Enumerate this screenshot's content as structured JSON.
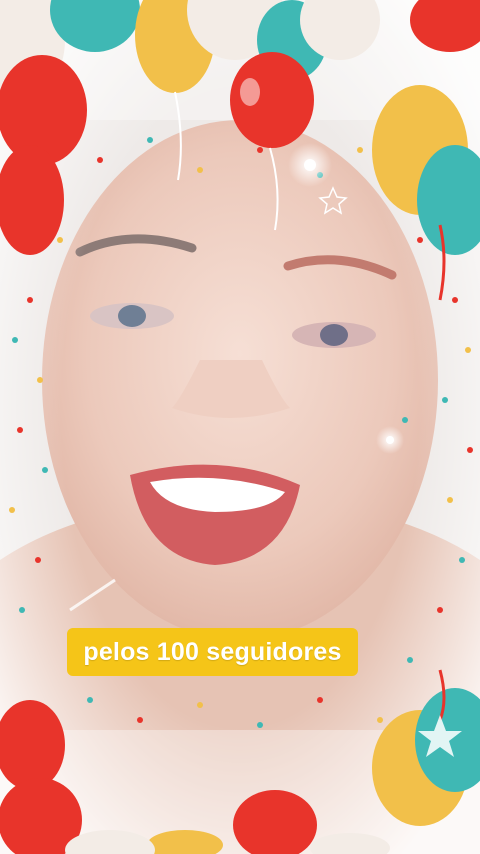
{
  "video": {
    "caption": "pelos 100 seguidores"
  },
  "overlay": {
    "effect": "birthday-balloons-frame",
    "balloon_colors": [
      "#e8342b",
      "#f2c04a",
      "#3fb8b4",
      "#f3ece6"
    ],
    "caption_background": "#f5c518",
    "caption_text_color": "#ffffff"
  }
}
